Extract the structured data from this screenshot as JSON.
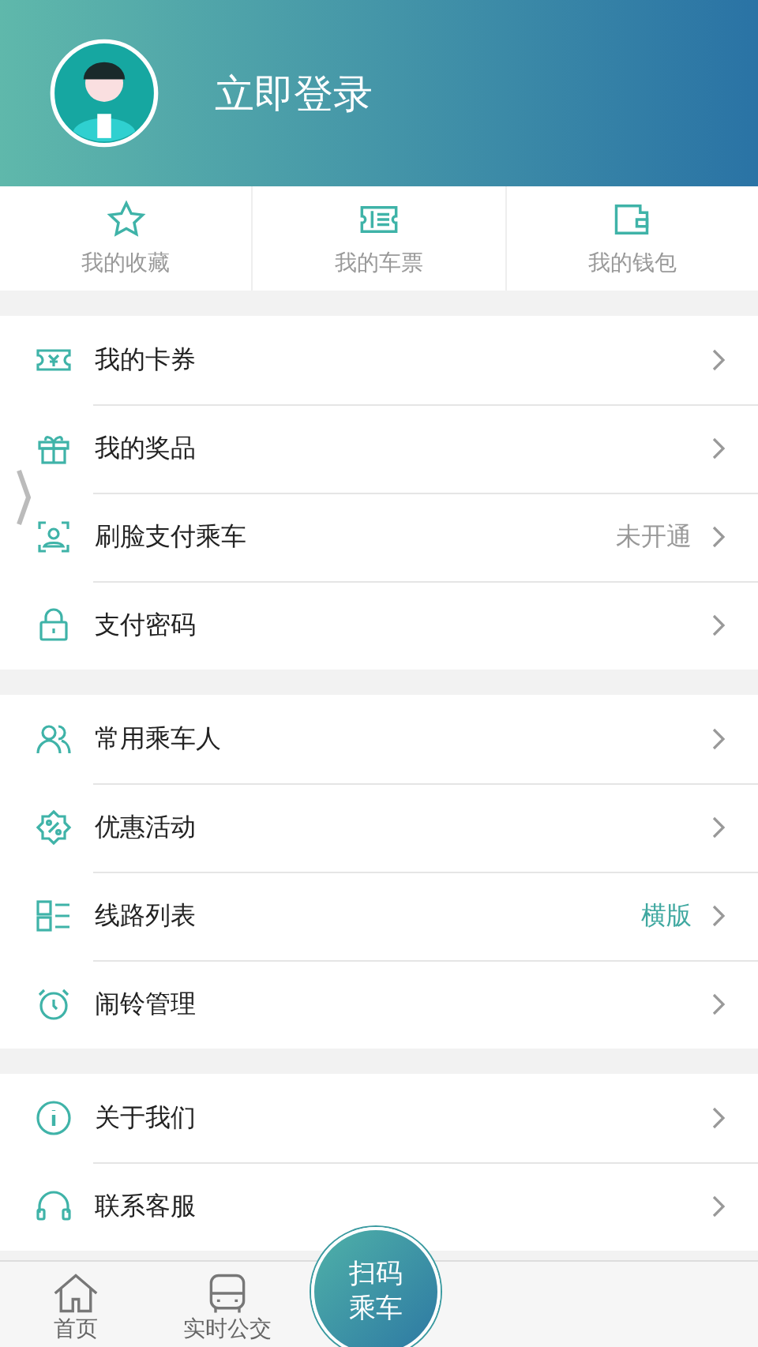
{
  "header": {
    "login_label": "立即登录"
  },
  "quick_links": [
    {
      "label": "我的收藏",
      "kind": "star"
    },
    {
      "label": "我的车票",
      "kind": "ticket"
    },
    {
      "label": "我的钱包",
      "kind": "wallet"
    }
  ],
  "menu_groups": [
    [
      {
        "label": "我的卡券",
        "kind": "coupon"
      },
      {
        "label": "我的奖品",
        "kind": "gift"
      },
      {
        "label": "刷脸支付乘车",
        "kind": "face",
        "value": {
          "text": "未开通",
          "kind": "muted"
        }
      },
      {
        "label": "支付密码",
        "kind": "lock"
      }
    ],
    [
      {
        "label": "常用乘车人",
        "kind": "people"
      },
      {
        "label": "优惠活动",
        "kind": "discount"
      },
      {
        "label": "线路列表",
        "kind": "list",
        "value": {
          "text": "横版",
          "kind": "accent"
        }
      },
      {
        "label": "闹铃管理",
        "kind": "alarm"
      }
    ],
    [
      {
        "label": "关于我们",
        "kind": "info"
      },
      {
        "label": "联系客服",
        "kind": "headset"
      }
    ]
  ],
  "tab_bar": {
    "tabs": [
      {
        "label": "首页",
        "kind": "home"
      },
      {
        "label": "实时公交",
        "kind": "bus"
      }
    ],
    "scan_button": {
      "line_1": "扫码",
      "line_2": "乘车"
    }
  }
}
